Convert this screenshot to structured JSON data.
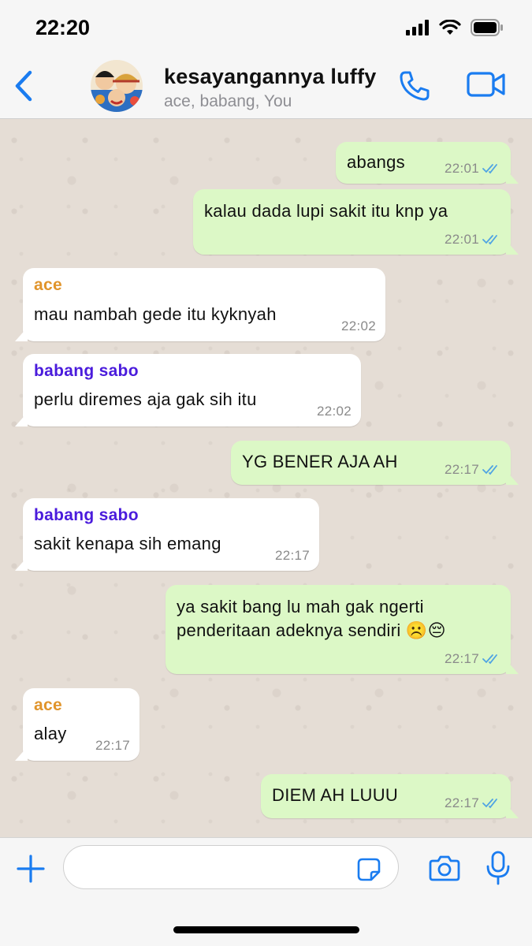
{
  "status": {
    "time": "22:20"
  },
  "header": {
    "title": "kesayangannya luffy",
    "subtitle": "ace, babang, You"
  },
  "colors": {
    "accent": "#1a7cf0",
    "outgoing_bubble": "#dcf8c6",
    "incoming_bubble": "#ffffff",
    "sender_ace": "#e0942b",
    "sender_sabo": "#4a1bdc",
    "read_ticks": "#4fa3e3"
  },
  "messages": [
    {
      "direction": "out",
      "text": "abangs",
      "time": "22:01",
      "read": true
    },
    {
      "direction": "out",
      "text": "kalau dada lupi sakit itu knp ya",
      "time": "22:01",
      "read": true
    },
    {
      "direction": "in",
      "sender": "ace",
      "text": "mau nambah gede itu kyknyah",
      "time": "22:02"
    },
    {
      "direction": "in",
      "sender": "babang sabo",
      "text": "perlu diremes aja gak sih itu",
      "time": "22:02"
    },
    {
      "direction": "out",
      "text": "YG BENER AJA AH",
      "time": "22:17",
      "read": true
    },
    {
      "direction": "in",
      "sender": "babang sabo",
      "text": "sakit kenapa sih emang",
      "time": "22:17"
    },
    {
      "direction": "out",
      "text_lines": [
        "ya sakit bang lu mah gak ngerti",
        "penderitaan adeknya sendiri ☹️😔"
      ],
      "time": "22:17",
      "read": true
    },
    {
      "direction": "in",
      "sender": "ace",
      "text": "alay",
      "time": "22:17"
    },
    {
      "direction": "out",
      "text": "DIEM AH LUUU",
      "time": "22:17",
      "read": true
    }
  ],
  "input": {
    "placeholder": ""
  }
}
